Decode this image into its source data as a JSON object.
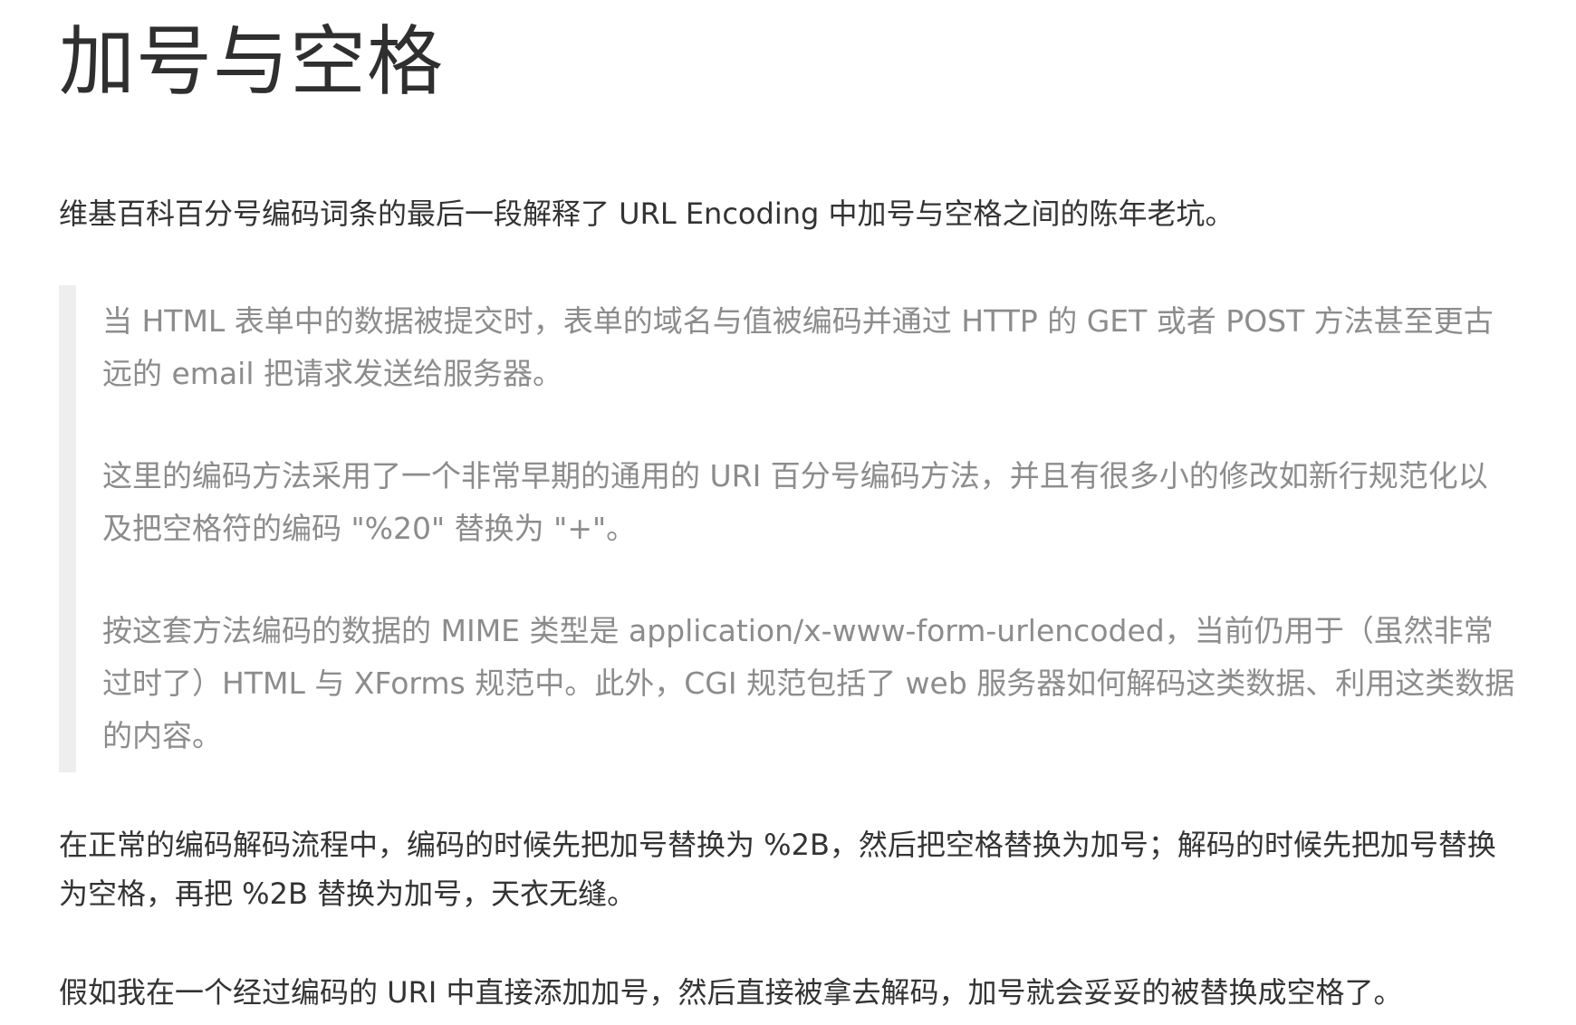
{
  "article": {
    "title": "加号与空格",
    "intro": "维基百科百分号编码词条的最后一段解释了 URL Encoding 中加号与空格之间的陈年老坑。",
    "quote": [
      "当 HTML 表单中的数据被提交时，表单的域名与值被编码并通过 HTTP 的 GET 或者 POST 方法甚至更古远的 email 把请求发送给服务器。",
      "这里的编码方法采用了一个非常早期的通用的 URI 百分号编码方法，并且有很多小的修改如新行规范化以及把空格符的编码 \"%20\" 替换为 \"+\"。",
      "按这套方法编码的数据的 MIME 类型是 application/x-www-form-urlencoded，当前仍用于（虽然非常过时了）HTML 与 XForms 规范中。此外，CGI 规范包括了 web 服务器如何解码这类数据、利用这类数据的内容。"
    ],
    "paragraph_1": "在正常的编码解码流程中，编码的时候先把加号替换为 %2B，然后把空格替换为加号；解码的时候先把加号替换为空格，再把 %2B 替换为加号，天衣无缝。",
    "paragraph_2": "假如我在一个经过编码的 URI 中直接添加加号，然后直接被拿去解码，加号就会妥妥的被替换成空格了。"
  }
}
